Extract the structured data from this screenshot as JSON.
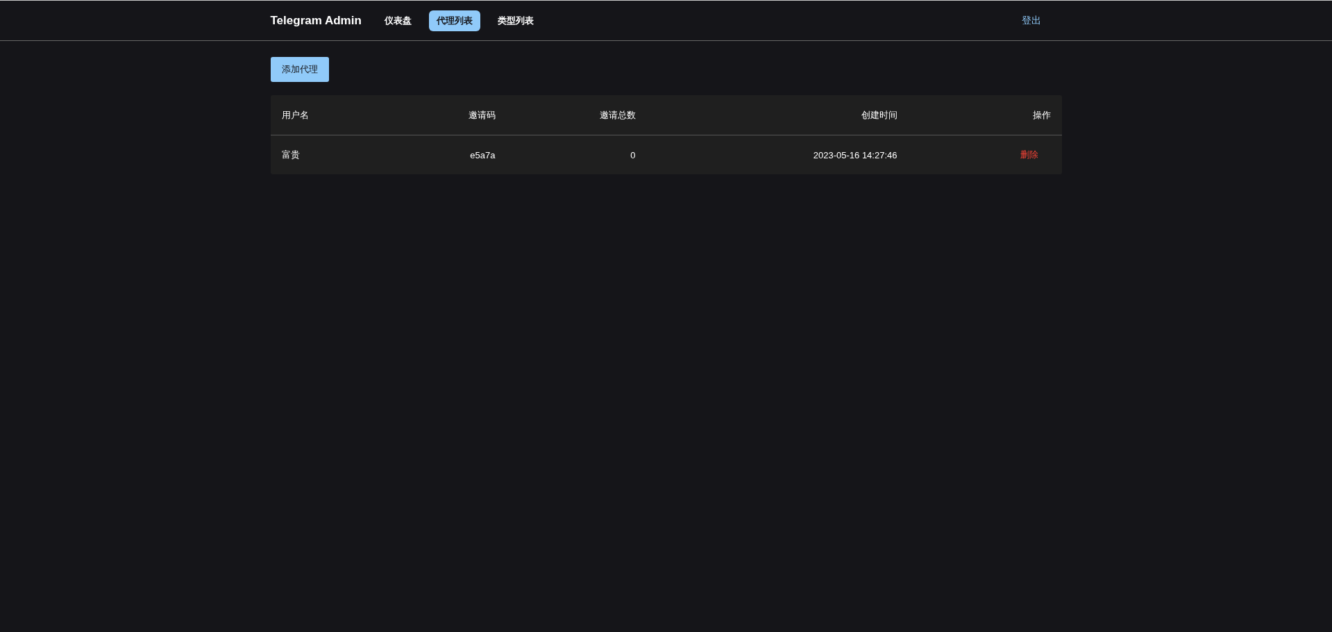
{
  "header": {
    "brand": "Telegram Admin",
    "nav": [
      {
        "label": "仪表盘",
        "selected": false
      },
      {
        "label": "代理列表",
        "selected": true
      },
      {
        "label": "类型列表",
        "selected": false
      }
    ],
    "logout": "登出"
  },
  "add_button": "添加代理",
  "table": {
    "columns": [
      "用户名",
      "邀请码",
      "邀请总数",
      "创建时间",
      "操作"
    ],
    "rows": [
      {
        "username": "富贵",
        "invite_code": "e5a7a",
        "invite_count": "0",
        "created": "2023-05-16 14:27:46",
        "action": "删除"
      }
    ]
  }
}
